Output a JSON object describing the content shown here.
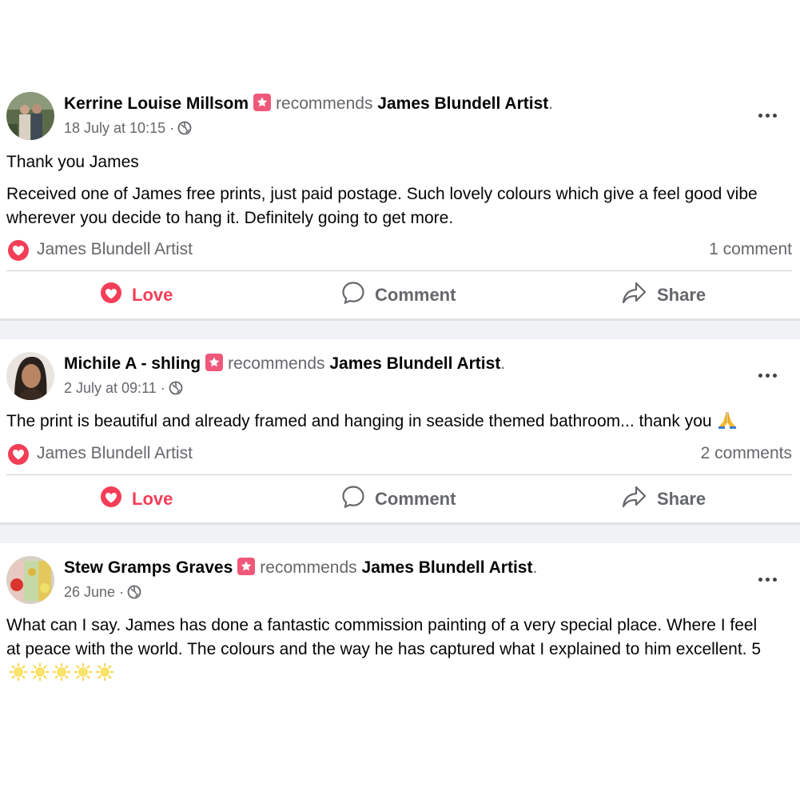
{
  "posts": [
    {
      "author": "Kerrine Louise Millsom",
      "recommends": "recommends",
      "page": "James Blundell Artist",
      "date": "18 July at 10:15",
      "dot": "·",
      "paragraphs": [
        "Thank you James",
        "Received one of James free prints, just paid postage. Such lovely colours which give a feel good vibe wherever you decide to hang it.  Definitely going to get more."
      ],
      "reaction_page": "James Blundell Artist",
      "comments": "1 comment"
    },
    {
      "author": "Michile A - shling",
      "recommends": "recommends",
      "page": "James Blundell Artist",
      "date": "2 July at 09:11",
      "dot": "·",
      "paragraphs": [
        "The print is beautiful and already framed and hanging in seaside themed bathroom... thank you"
      ],
      "emoji": "folded-hands-emoji",
      "reaction_page": "James Blundell Artist",
      "comments": "2 comments"
    },
    {
      "author": "Stew Gramps Graves",
      "recommends": "recommends",
      "page": "James Blundell Artist",
      "date": "26 June",
      "dot": "·",
      "paragraphs": [
        "What can I say. James has done a fantastic commission painting of a very special place. Where I feel at peace with the world. The colours and the way he has captured what I explained to him excellent. 5"
      ],
      "emoji": "sun-emoji x5"
    }
  ],
  "actions": {
    "love": "Love",
    "comment": "Comment",
    "share": "Share"
  },
  "colors": {
    "love": "#f33e58",
    "secondary_text": "#65676b",
    "recommend_badge": "#f0587a",
    "feed_gap": "#f0f2f5"
  },
  "icons": [
    "recommend-badge-icon",
    "globe-icon",
    "more-options-icon",
    "love-heart-icon",
    "comment-bubble-icon",
    "share-arrow-icon"
  ]
}
